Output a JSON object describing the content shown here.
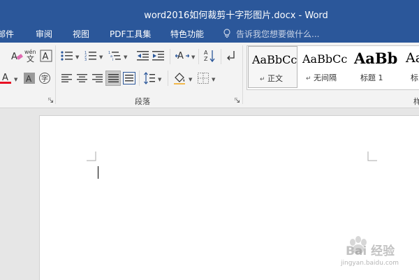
{
  "window": {
    "title": "word2016如何裁剪十字形图片.docx - Word"
  },
  "tabs": [
    {
      "label": "邮件"
    },
    {
      "label": "审阅"
    },
    {
      "label": "视图"
    },
    {
      "label": "PDF工具集"
    },
    {
      "label": "特色功能"
    }
  ],
  "tell_me": {
    "placeholder": "告诉我您想要做什么..."
  },
  "ribbon": {
    "paragraph_group_label": "段落",
    "styles_group_label_partial": "样",
    "phonetic_glyph": "wén"
  },
  "styles": [
    {
      "sample": "AaBbCc",
      "name": "正文",
      "active": true
    },
    {
      "sample": "AaBbCc",
      "name": "无间隔",
      "active": false
    },
    {
      "sample": "AaBb",
      "name": "标题 1",
      "active": false
    },
    {
      "sample": "Aa",
      "name": "标",
      "active": false
    }
  ],
  "watermark": {
    "brand": "Bai 经验",
    "url": "jingyan.baidu.com"
  },
  "colors": {
    "title_bar": "#2b579a",
    "ribbon_bg": "#f3f3f3",
    "font_color_underline": "#e81123"
  }
}
